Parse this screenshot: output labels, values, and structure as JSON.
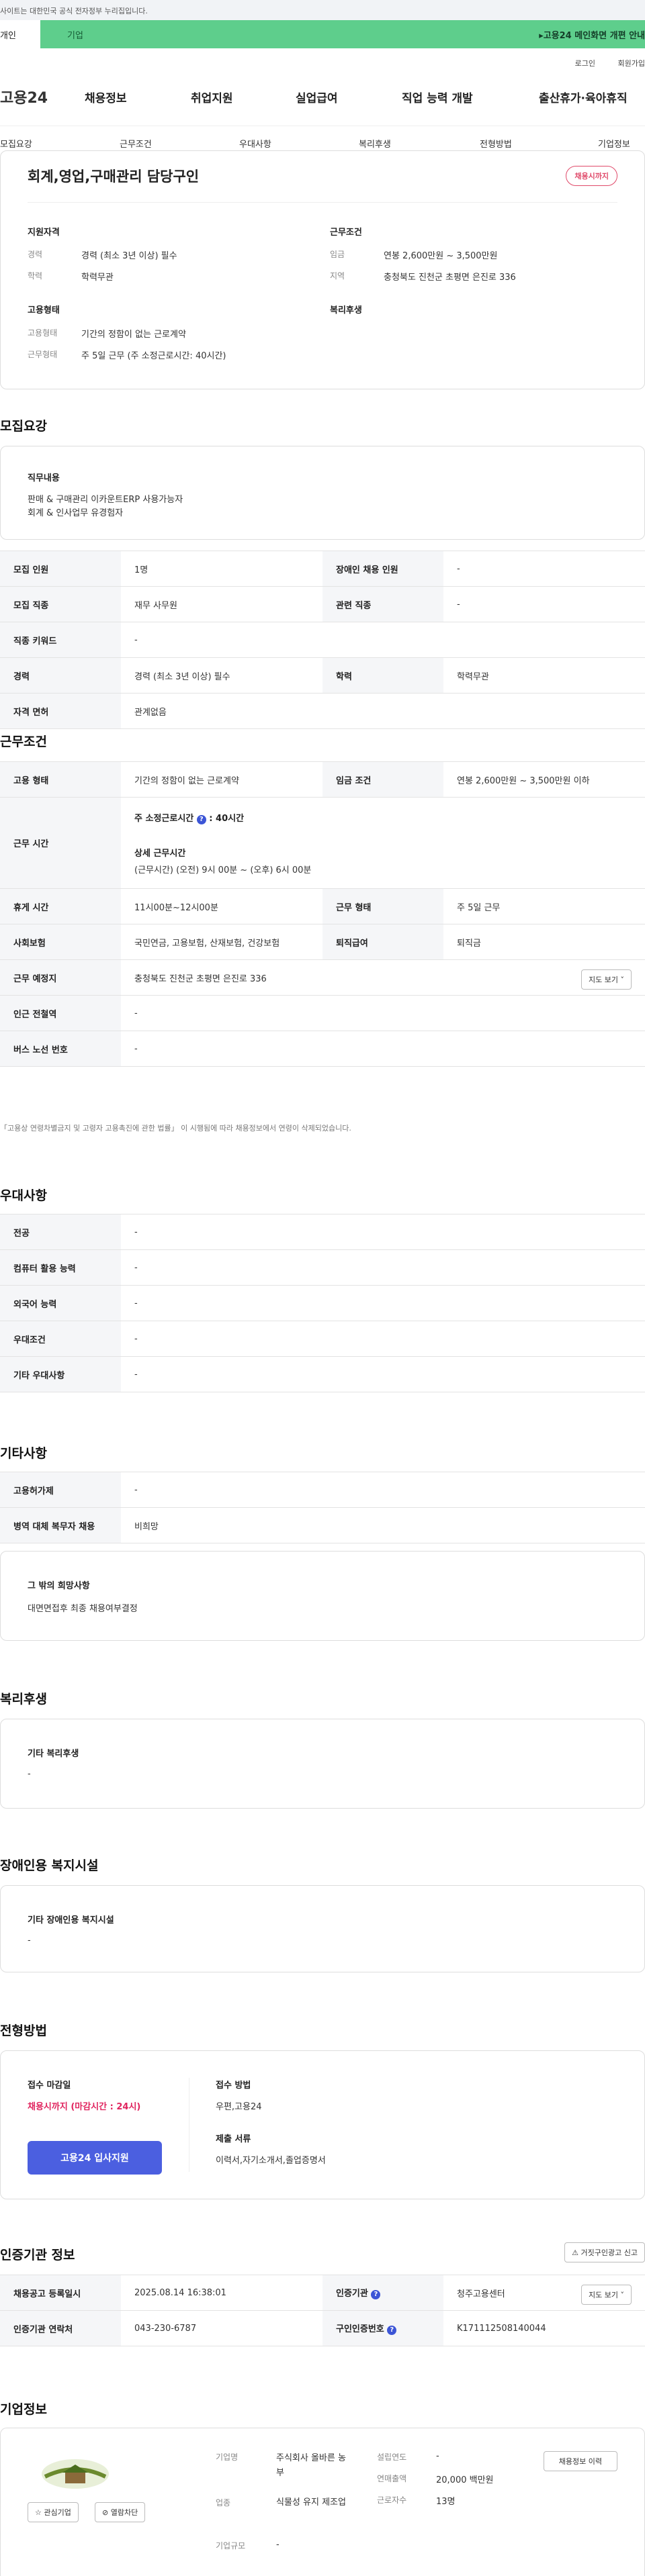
{
  "gov_notice": "사이트는 대한민국 공식 전자정부 누리집입니다.",
  "top_tabs": {
    "individual": "개인",
    "company": "기업"
  },
  "ticker": "고용24 메인화면 개편 안내",
  "util": {
    "login": "로그인",
    "signup": "회원가입"
  },
  "logo": "고용24",
  "gnb": [
    "채용정보",
    "취업지원",
    "실업급여",
    "직업 능력 개발",
    "출산휴가·육아휴직"
  ],
  "lnb": [
    "모집요강",
    "근무조건",
    "우대사항",
    "복리후생",
    "전형방법",
    "기업정보"
  ],
  "job": {
    "title": "회계,영업,구매관리 담당구인",
    "status_badge": "채용시까지",
    "qual": {
      "heading": "지원자격",
      "career_k": "경력",
      "career_v": "경력 (최소 3년 이상) 필수",
      "edu_k": "학력",
      "edu_v": "학력무관"
    },
    "cond": {
      "heading": "근무조건",
      "wage_k": "임금",
      "wage_v": "연봉 2,600만원 ~ 3,500만원",
      "region_k": "지역",
      "region_v": "충청북도 진천군 초평면 은진로 336"
    },
    "emp": {
      "heading": "고용형태",
      "type_k": "고용형태",
      "type_v": "기간의 정함이 없는 근로계약",
      "time_k": "근무형태",
      "time_v": "주 5일 근무 (주 소정근로시간: 40시간)"
    },
    "welfare": {
      "heading": "복리후생"
    }
  },
  "recruit": {
    "title": "모집요강",
    "duty_heading": "직무내용",
    "duty_lines": [
      "판매 & 구매관리 이카운트ERP 사용가능자",
      "회계 & 인사업무 유경험자"
    ],
    "table": [
      [
        {
          "k": "모집 인원",
          "v": "1명"
        },
        {
          "k": "장애인 채용 인원",
          "v": "-"
        }
      ],
      [
        {
          "k": "모집 직종",
          "v": "재무 사무원"
        },
        {
          "k": "관련 직종",
          "v": "-"
        }
      ],
      [
        {
          "k": "직종 키워드",
          "v": "-"
        }
      ],
      [
        {
          "k": "경력",
          "v": "경력 (최소 3년 이상) 필수"
        },
        {
          "k": "학력",
          "v": "학력무관"
        }
      ],
      [
        {
          "k": "자격 면허",
          "v": "관계없음"
        }
      ]
    ]
  },
  "work": {
    "title": "근무조건",
    "emp_type_k": "고용 형태",
    "emp_type_v": "기간의 정함이 없는 근로계약",
    "wage_k": "임금 조건",
    "wage_v": "연봉 2,600만원 ~ 3,500만원 이하",
    "hours_k": "근무 시간",
    "hours_main": "주 소정근로시간",
    "hours_value": "40시간",
    "hours_detail_label": "상세 근무시간",
    "hours_detail": "(근무시간) (오전) 9시 00분 ~ (오후) 6시 00분",
    "break_k": "휴게 시간",
    "break_v": "11시00분~12시00분",
    "form_k": "근무 형태",
    "form_v": "주 5일 근무",
    "insurance_k": "사회보험",
    "insurance_v": "국민연금, 고용보험, 산재보험, 건강보험",
    "retire_k": "퇴직급여",
    "retire_v": "퇴직금",
    "place_k": "근무 예정지",
    "place_v": "충청북도 진천군 초평면 은진로 336",
    "map_btn": "지도 보기",
    "subway_k": "인근 전철역",
    "subway_v": "-",
    "bus_k": "버스 노선 번호",
    "bus_v": "-",
    "note": "「고용상 연령차별금지 및 고령자 고용촉진에 관한 법률」 이 시행됨에 따라 채용정보에서 연령이 삭제되었습니다."
  },
  "pref": {
    "title": "우대사항",
    "rows": [
      {
        "k": "전공",
        "v": "-"
      },
      {
        "k": "컴퓨터 활용 능력",
        "v": "-"
      },
      {
        "k": "외국어 능력",
        "v": "-"
      },
      {
        "k": "우대조건",
        "v": "-"
      },
      {
        "k": "기타 우대사항",
        "v": "-"
      }
    ]
  },
  "etc": {
    "title": "기타사항",
    "rows": [
      {
        "k": "고용허가제",
        "v": "-"
      },
      {
        "k": "병역 대체 복무자 채용",
        "v": "비희망"
      }
    ],
    "other_heading": "그 밖의 희망사항",
    "other_v": "대면면접후 최종 채용여부결정"
  },
  "benefit": {
    "title": "복리후생",
    "heading": "기타 복리후생",
    "v": "-"
  },
  "disabled": {
    "title": "장애인용 복지시설",
    "heading": "기타 장애인용 복지시설",
    "v": "-"
  },
  "process": {
    "title": "전형방법",
    "deadline_label": "접수 마감일",
    "deadline_value": "채용시까지 (마감시간 : 24시)",
    "apply_btn": "고용24 입사지원",
    "method_label": "접수 방법",
    "method_value": "우편,고용24",
    "docs_label": "제출 서류",
    "docs_value": "이력서,자기소개서,졸업증명서"
  },
  "cert": {
    "title": "인증기관 정보",
    "report_btn": "거짓구인광고 신고",
    "reg_k": "채용공고 등록일시",
    "reg_v": "2025.08.14 16:38:01",
    "org_k": "인증기관",
    "org_v": "청주고용센터",
    "map_btn": "지도 보기",
    "tel_k": "인증기관 연락처",
    "tel_v": "043-230-6787",
    "id_k": "구인인증번호",
    "id_v": "K171112508140044"
  },
  "company": {
    "title": "기업정보",
    "fav": "관심기업",
    "block": "열람차단",
    "name_k": "기업명",
    "name_v": "주식회사 올바른 농부",
    "ind_k": "업종",
    "ind_v": "식물성 유지 제조업",
    "size_k": "기업규모",
    "size_v": "-",
    "est_k": "설립연도",
    "est_v": "-",
    "sales_k": "연매출액",
    "sales_v": "20,000 백만원",
    "emp_k": "근로자수",
    "emp_v": "13명",
    "history_btn": "채용정보 이력"
  }
}
